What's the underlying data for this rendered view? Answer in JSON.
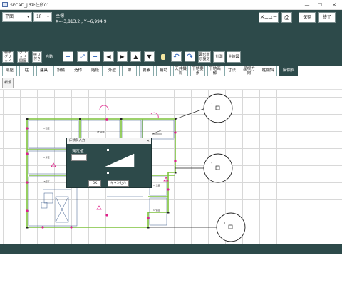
{
  "window": {
    "title": "SFCAD_j  ﾃｽﾄ住所01",
    "minimize_glyph": "—",
    "maximize_glyph": "☐",
    "close_glyph": "✕"
  },
  "toolbar": {
    "view_select": "平面",
    "floor_select": "1F",
    "coord_title": "座標",
    "coord_value": "X=-3,813.2 , Y=6,994.9",
    "btn_standard_grid": "標準グリッド",
    "btn_grid_interval": "グリッド間隔",
    "btn_snap": "吸り付き",
    "btn_auto": "自動",
    "btn_zoom_in": "+",
    "btn_zoom_area": "⤢",
    "btn_zoom_out": "−",
    "btn_left": "◀",
    "btn_right": "▶",
    "btn_up": "▲",
    "btn_down": "▼",
    "btn_undo": "↶",
    "btn_redo": "↷",
    "btn_display_settings": "図形表示設定",
    "btn_measure": "計測",
    "btn_full_drawing": "全館図",
    "btn_menu": "メニュー",
    "btn_print": "⎙",
    "btn_save": "保存",
    "btn_exit": "終了"
  },
  "tabs": [
    {
      "label": "部屋"
    },
    {
      "label": "柱"
    },
    {
      "label": "建具"
    },
    {
      "label": "設備"
    },
    {
      "label": "造作"
    },
    {
      "label": "階段"
    },
    {
      "label": "外壁"
    },
    {
      "label": "線"
    },
    {
      "label": "要素"
    },
    {
      "label": "補助"
    },
    {
      "label": "天井撮影"
    },
    {
      "label": "下地要素"
    },
    {
      "label": "下地画像"
    },
    {
      "label": "寸法"
    },
    {
      "label": "屋根方向"
    },
    {
      "label": "柱傾斜"
    },
    {
      "label": "床傾斜"
    }
  ],
  "subbar": {
    "btn_new": "新規"
  },
  "dialog": {
    "title": "床傾斜入力",
    "close": "✕",
    "label": "測定値",
    "input_value": "",
    "ok": "OK",
    "cancel": "キャンセル"
  },
  "canvas": {
    "callout_upper": "1",
    "callout_middle": "1",
    "callout_lower": "1",
    "room_labels": [
      "洋室",
      "浴室",
      "洗面所",
      "廊下",
      "LDK",
      "和室",
      "玄関",
      "トイレ",
      "物入"
    ]
  },
  "colors": {
    "toolbar_bg": "#2d4a4a",
    "wall_green": "#7dc23b",
    "marker_magenta": "#e0208a",
    "active_tab": "#2d4a4a"
  }
}
